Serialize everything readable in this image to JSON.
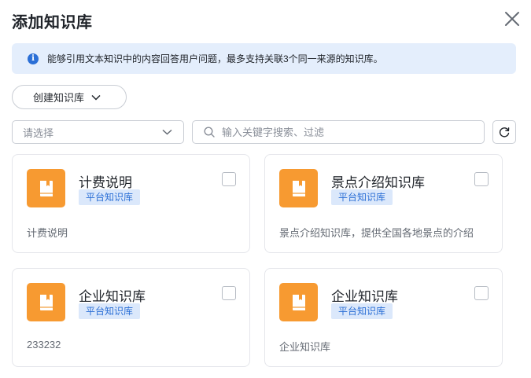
{
  "dialog": {
    "title": "添加知识库"
  },
  "info": {
    "text": "能够引用文本知识中的内容回答用户问题，最多支持关联3个同一来源的知识库。"
  },
  "toolbar": {
    "create_label": "创建知识库",
    "select_placeholder": "请选择",
    "search_placeholder": "输入关键字搜索、过滤"
  },
  "cards": [
    {
      "name": "计费说明",
      "badge": "平台知识库",
      "desc": "计费说明",
      "checked": false
    },
    {
      "name": "景点介绍知识库",
      "badge": "平台知识库",
      "desc": "景点介绍知识库，提供全国各地景点的介绍",
      "checked": false
    },
    {
      "name": "企业知识库",
      "badge": "平台知识库",
      "desc": "233232",
      "checked": false
    },
    {
      "name": "企业知识库",
      "badge": "平台知识库",
      "desc": "企业知识库",
      "checked": false
    }
  ],
  "colors": {
    "accent": "#2b6fd6",
    "banner_bg": "#e4eefc",
    "book_icon": "#f79a31",
    "badge_bg": "#dbe8fb"
  },
  "icons": {
    "close": "close-icon",
    "info": "info-icon",
    "chevron": "chevron-down-icon",
    "search": "search-icon",
    "refresh": "refresh-icon",
    "book": "book-icon"
  }
}
